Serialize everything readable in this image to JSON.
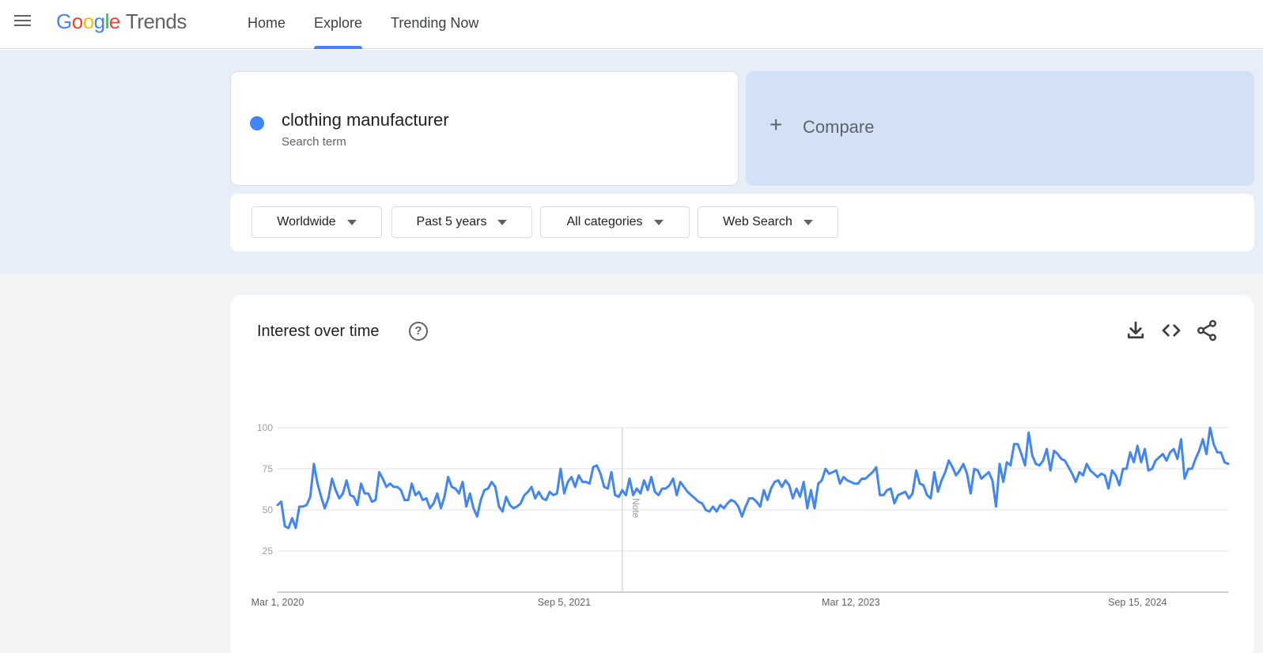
{
  "header": {
    "logo_letters": [
      "G",
      "o",
      "o",
      "g",
      "l",
      "e"
    ],
    "logo_product": "Trends",
    "nav": [
      {
        "label": "Home",
        "active": false
      },
      {
        "label": "Explore",
        "active": true
      },
      {
        "label": "Trending Now",
        "active": false
      }
    ],
    "icons": {
      "menu": "hamburger-menu-icon"
    }
  },
  "search_term": {
    "title": "clothing manufacturer",
    "subtitle": "Search term",
    "color": "#4285f4"
  },
  "compare": {
    "label": "Compare",
    "icon": "plus-icon"
  },
  "filters": {
    "region": "Worldwide",
    "time": "Past 5 years",
    "category": "All categories",
    "property": "Web Search"
  },
  "chart_card": {
    "title": "Interest over time",
    "icons": [
      "help-icon",
      "download-icon",
      "embed-code-icon",
      "share-icon"
    ]
  },
  "colors": {
    "accent": "#4285f4",
    "band": "#e8eef7",
    "compare_bg": "#d2e1f6"
  },
  "chart_data": {
    "type": "line",
    "ylim": [
      0,
      100
    ],
    "yticks": [
      25,
      50,
      75,
      100
    ],
    "xtick_labels": [
      "Mar 1, 2020",
      "Sep 5, 2021",
      "Mar 12, 2023",
      "Sep 15, 2024"
    ],
    "x_start": "2020-03-01",
    "x_step_weeks": 1,
    "annotation": {
      "label": "Note",
      "date": "2021-12-26"
    },
    "grid": true,
    "series": [
      {
        "color": "#4285f4",
        "values": [
          53,
          55,
          40,
          39,
          45,
          39,
          52,
          52,
          53,
          58,
          78,
          66,
          58,
          51,
          57,
          69,
          62,
          57,
          60,
          68,
          59,
          58,
          53,
          66,
          60,
          60,
          55,
          56,
          73,
          69,
          64,
          66,
          64,
          64,
          62,
          56,
          56,
          66,
          59,
          61,
          56,
          57,
          51,
          54,
          60,
          51,
          58,
          70,
          64,
          63,
          60,
          67,
          52,
          60,
          51,
          46,
          56,
          62,
          63,
          67,
          64,
          52,
          49,
          58,
          53,
          51,
          52,
          54,
          59,
          61,
          64,
          57,
          61,
          57,
          56,
          61,
          59,
          60,
          75,
          60,
          67,
          70,
          64,
          71,
          67,
          67,
          66,
          76,
          77,
          72,
          64,
          63,
          73,
          59,
          58,
          62,
          59,
          69,
          59,
          63,
          60,
          68,
          62,
          70,
          61,
          59,
          63,
          63,
          65,
          69,
          59,
          67,
          64,
          61,
          59,
          57,
          55,
          54,
          50,
          49,
          52,
          49,
          53,
          51,
          54,
          56,
          55,
          52,
          46,
          52,
          57,
          57,
          55,
          52,
          62,
          56,
          63,
          67,
          68,
          64,
          68,
          65,
          57,
          63,
          58,
          67,
          51,
          62,
          51,
          66,
          68,
          75,
          72,
          73,
          74,
          66,
          70,
          68,
          67,
          66,
          66,
          69,
          69,
          71,
          73,
          76,
          59,
          59,
          62,
          63,
          54,
          59,
          60,
          61,
          57,
          60,
          74,
          66,
          65,
          59,
          57,
          73,
          61,
          68,
          73,
          80,
          76,
          71,
          74,
          78,
          72,
          60,
          75,
          74,
          69,
          71,
          73,
          68,
          52,
          78,
          67,
          79,
          77,
          90,
          90,
          84,
          77,
          97,
          83,
          78,
          77,
          80,
          87,
          74,
          86,
          84,
          81,
          80,
          76,
          72,
          67,
          73,
          71,
          78,
          74,
          72,
          70,
          72,
          71,
          63,
          74,
          71,
          65,
          75,
          75,
          85,
          79,
          89,
          79,
          87,
          74,
          75,
          80,
          82,
          84,
          80,
          85,
          87,
          81,
          93,
          69,
          75,
          75,
          81,
          86,
          93,
          84,
          100,
          90,
          85,
          85,
          79,
          78
        ]
      }
    ]
  }
}
